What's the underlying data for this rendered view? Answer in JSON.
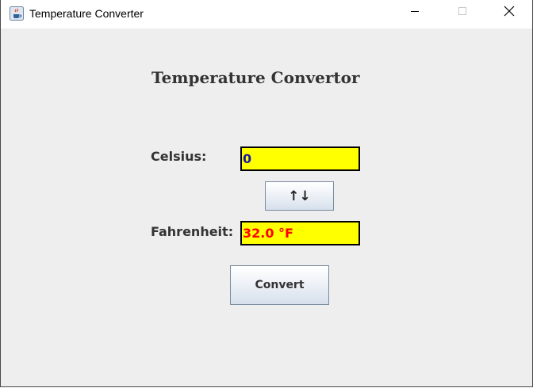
{
  "window": {
    "title": "Temperature Converter",
    "app_icon": "java-coffee-cup-icon"
  },
  "window_controls": {
    "minimize_icon": "minimize-icon",
    "maximize_icon": "maximize-icon",
    "close_icon": "close-icon"
  },
  "main": {
    "heading": "Temperature Convertor",
    "celsius_label": "Celsius:",
    "celsius_value": "0",
    "swap_label": "↑↓",
    "fahrenheit_label": "Fahrenheit:",
    "fahrenheit_value": "32.0 °F",
    "convert_label": "Convert"
  },
  "colors": {
    "field_background": "#ffff00",
    "celsius_text": "#1a1aa8",
    "fahrenheit_text": "#ff0000",
    "window_background": "#eeeeee"
  }
}
